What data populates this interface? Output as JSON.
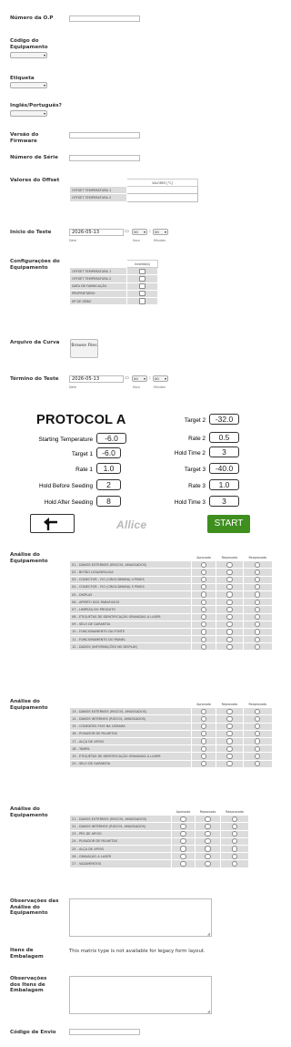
{
  "fields": {
    "op_number": "Número da O.P",
    "equipment_code": "Código do Equipamento",
    "label": "Etiqueta",
    "language": "Inglês/Português?",
    "firmware_version": "Versão do Firmware",
    "serial_number": "Número de Série",
    "offset_values": "Valores do Offset",
    "test_start": "Início do Teste",
    "equipment_config": "Configurações do Equipamento",
    "curve_file": "Arquivo da Curva",
    "test_end": "Término do Teste",
    "equipment_analysis": "Análise do Equipamento",
    "analysis_notes": "Observações das Análise do Equipamento",
    "packaging_items": "Itens de Embalagem",
    "packaging_notes": "Observações dos Itens de Embalagem",
    "shipping_code": "Código de Envio"
  },
  "offset_table": {
    "header": "VALORES [°C]",
    "rows": [
      "OFFSET TEMPERATURA 1",
      "OFFSET TEMPERATURA 2"
    ]
  },
  "datetime_start": {
    "date": "2026-05-13",
    "hour": "00",
    "minute": "00",
    "date_caption": "Date",
    "hour_caption": "Hour",
    "minute_caption": "Minutes"
  },
  "datetime_end": {
    "date": "2026-05-13",
    "hour": "00",
    "minute": "00",
    "date_caption": "Date",
    "hour_caption": "Hour",
    "minute_caption": "Minutes"
  },
  "config_table": {
    "header": "Inválido(s)",
    "rows": [
      "OFFSET TEMPERATURA 1",
      "OFFSET TEMPERATURA 2",
      "DATA DE FABRICAÇÃO",
      "PROPRIETÁRIO",
      "Nº DE SÉRIE"
    ]
  },
  "browse_button": "Browse Files",
  "protocol": {
    "title": "PROTOCOL A",
    "left": [
      {
        "label": "Starting Temperature",
        "value": "-6.0"
      },
      {
        "label": "Target 1",
        "value": "-6.0"
      },
      {
        "label": "Rate 1",
        "value": "1.0"
      },
      {
        "label": "Hold Before Seeding",
        "value": "2"
      },
      {
        "label": "Hold After Seeding",
        "value": "8"
      }
    ],
    "right": [
      {
        "label": "Target 2",
        "value": "-32.0"
      },
      {
        "label": "Rate 2",
        "value": "0.5"
      },
      {
        "label": "Hold Time 2",
        "value": "3"
      },
      {
        "label": "Target 3",
        "value": "-40.0"
      },
      {
        "label": "Rate 3",
        "value": "1.0"
      },
      {
        "label": "Hold Time 3",
        "value": "3"
      }
    ],
    "logo": "Allice",
    "start_button": "START",
    "start_color": "#3f8f1f"
  },
  "analysis_headers": [
    "Aprovado",
    "Reprovado",
    "Reaprovado"
  ],
  "analysis_1": [
    "01 - DANOS EXTERNOS (RISCOS, AMASSADOS)",
    "02 - BOTÃO LIGA/DESLIGA",
    "03 - CONECTOR - FIO (CRIOCÂMARA) 4 PINOS",
    "04 - CONECTOR - FIO (CRIOCÂMARA) 5 PINOS",
    "05 - DISPLAY",
    "06 - APERTO DOS PARAFUSOS",
    "07 - LIMPEZA DO PRODUTO",
    "08 - ETIQUETAS DE IDENTIFICAÇÃO GRAVADAS A LASER",
    "09 - SELO DE GARANTIA",
    "10 - FUNCIONAMENTO DA FONTE",
    "11 - FUNCIONAMENTO DO PAINEL",
    "12 - DADOS (INFORMAÇÕES NO DISPLAY)"
  ],
  "analysis_2": [
    "13 - DANOS EXTERNOS (RISCOS, AMASSADOS)",
    "14 - DANOS INTERNOS (RISCOS, AMASSADOS)",
    "15 - CONEXÕES FIOS NA CÂMARA",
    "16 - PUXADOR DE PALHETAS",
    "17 - ALÇA DE APOIO",
    "18 - TAMPA",
    "19 - ETIQUETAS DE IDENTIFICAÇÃO GRAVADAS A LASER",
    "20 - SELO DE GARANTIA"
  ],
  "analysis_3": [
    "21 - DANOS EXTERNOS (RISCOS, AMASSADOS)",
    "22 - DANOS INTERNOS (RISCOS, AMASSADOS)",
    "23 - PÉS DE APOIO",
    "24 - PUXADOR DE PALHETAS",
    "25 - ALÇA DE APOIO",
    "26 - GRAVAÇÃO A LASER",
    "27 - VAZAMENTOS"
  ],
  "packaging_message": "This matrix type is not available for legacy form layout."
}
